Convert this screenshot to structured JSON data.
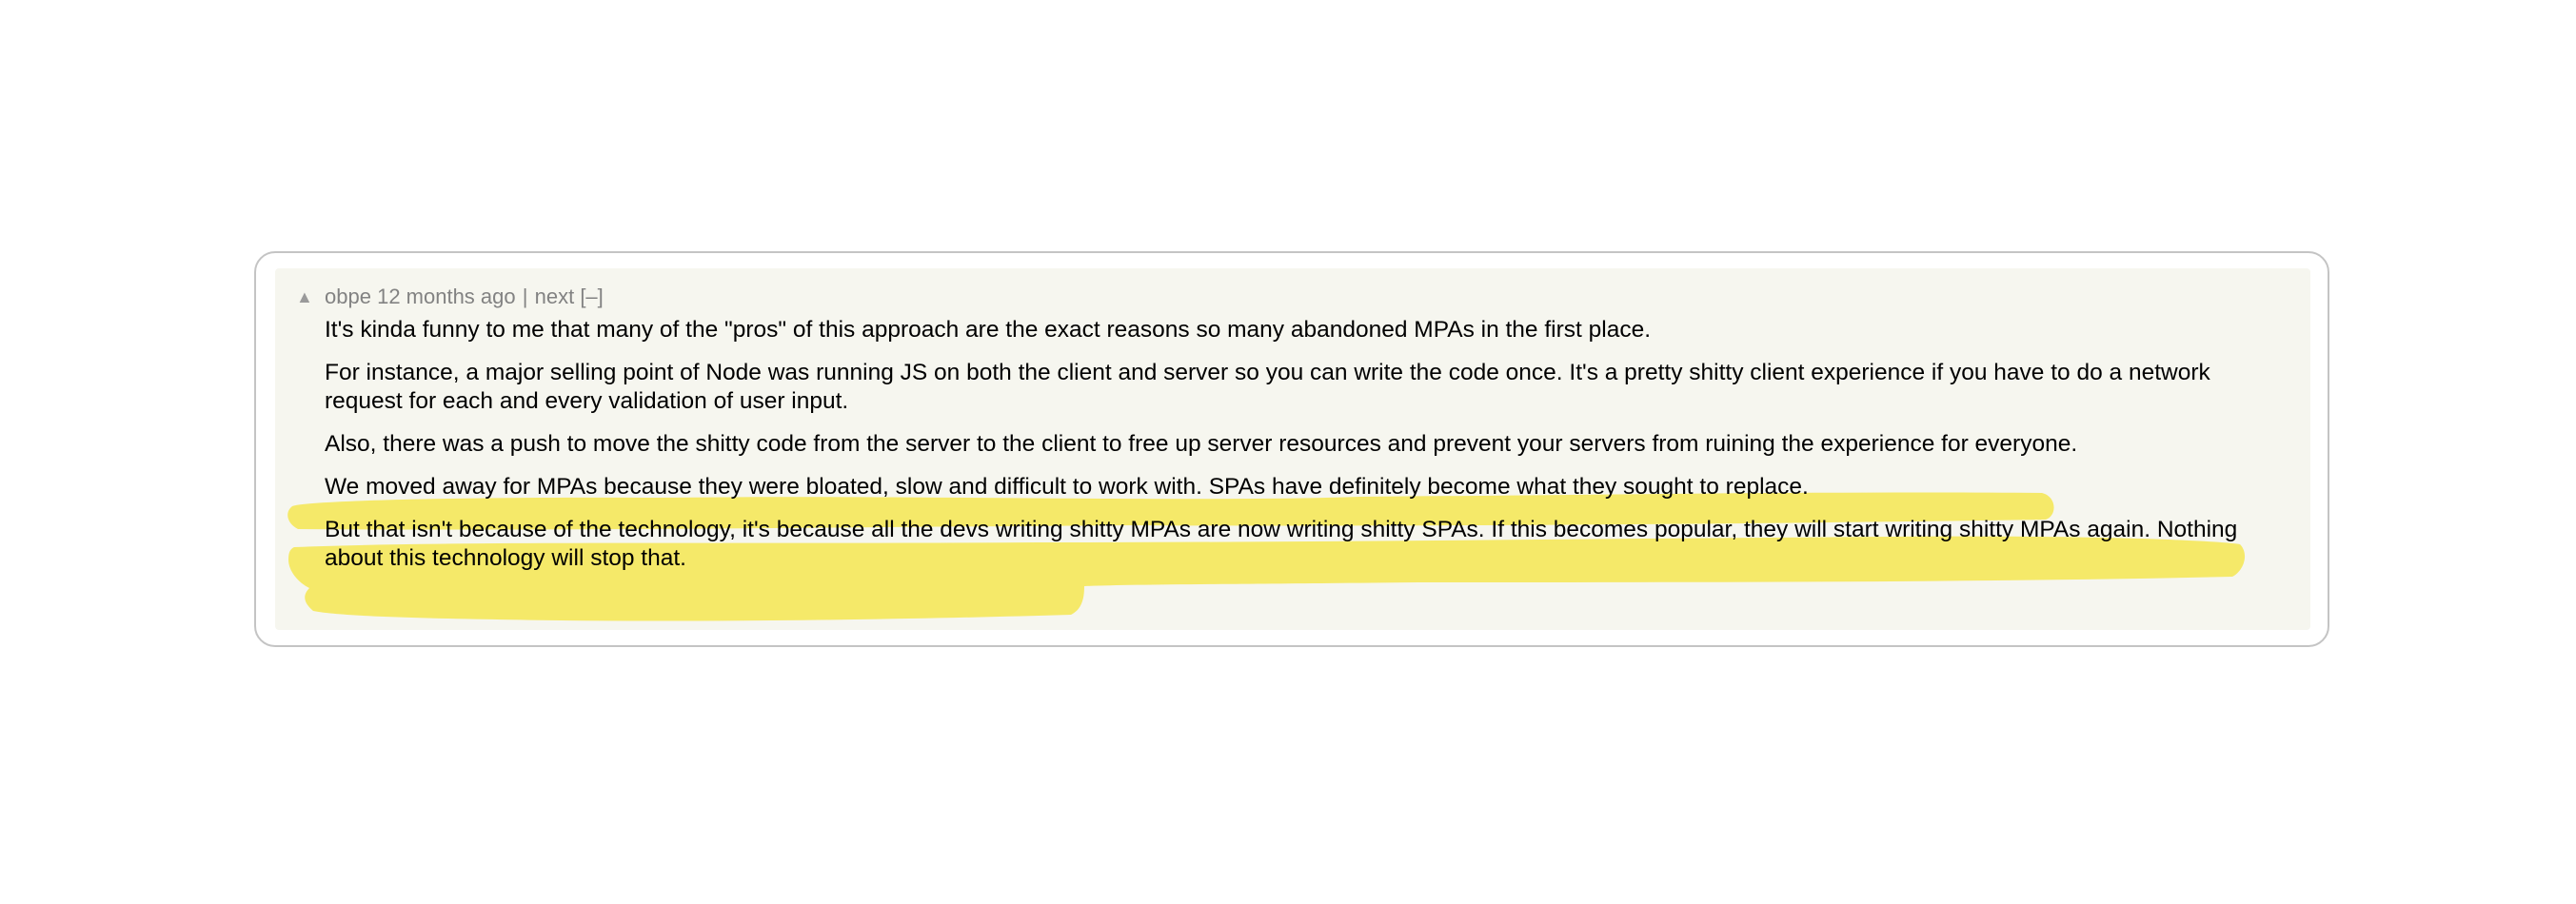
{
  "comment": {
    "vote_icon": "upvote-triangle-icon",
    "username": "obpe",
    "age": "12 months ago",
    "separator": "|",
    "next_label": "next",
    "collapse_label": "[–]",
    "paragraphs": [
      "It's kinda funny to me that many of the \"pros\" of this approach are the exact reasons so many abandoned MPAs in the first place.",
      "For instance, a major selling point of Node was running JS on both the client and server so you can write the code once. It's a pretty shitty client experience if you have to do a network request for each and every validation of user input.",
      "Also, there was a push to move the shitty code from the server to the client to free up server resources and prevent your servers from ruining the experience for everyone.",
      "We moved away for MPAs because they were bloated, slow and difficult to work with. SPAs have definitely become what they sought to replace.",
      "But that isn't because of the technology, it's because all the devs writing shitty MPAs are now writing shitty SPAs. If this becomes popular, they will start writing shitty MPAs again. Nothing about this technology will stop that."
    ]
  },
  "colors": {
    "background": "#f6f6ef",
    "meta_text": "#828282",
    "highlight": "#f5e651",
    "border": "#c4c4c4"
  }
}
